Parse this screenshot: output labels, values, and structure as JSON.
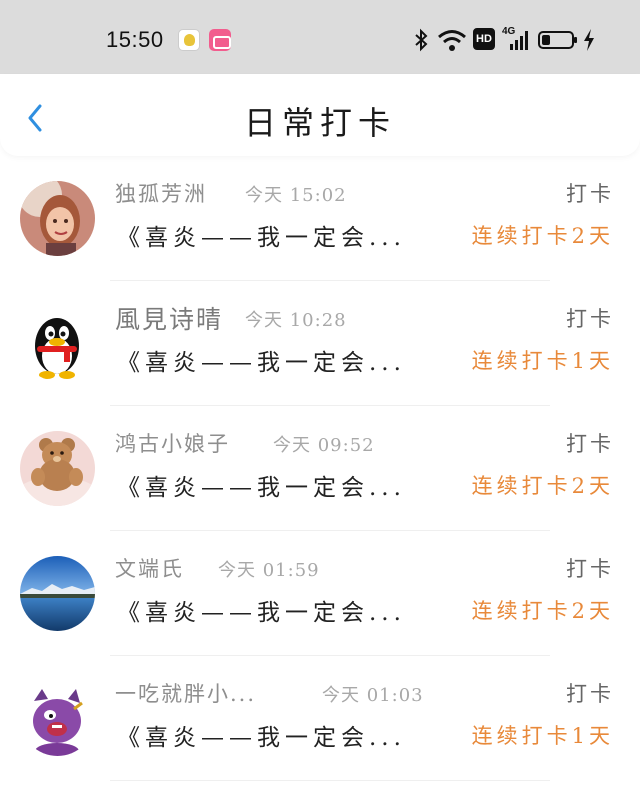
{
  "status_bar": {
    "time": "15:50",
    "icons": [
      "app-icon-1",
      "bilibili-icon",
      "bluetooth-icon",
      "wifi-icon",
      "hd-icon",
      "signal-4g-icon",
      "battery-icon",
      "charging-icon"
    ],
    "hd_label": "HD",
    "network_label": "4G"
  },
  "header": {
    "title": "日常打卡",
    "back_icon": "chevron-left-icon"
  },
  "colors": {
    "accent": "#2f8fe0",
    "streak": "#e8893a",
    "status_bar_bg": "#dcdcdc"
  },
  "checkins": [
    {
      "name": "独孤芳洲",
      "time": "今天 15:02",
      "action": "打卡",
      "content": "《喜炎——我一定会...",
      "streak": "连续打卡2天",
      "avatar": "girl-photo"
    },
    {
      "name": "風見诗晴",
      "time": "今天 10:28",
      "action": "打卡",
      "content": "《喜炎——我一定会...",
      "streak": "连续打卡1天",
      "avatar": "qq-penguin"
    },
    {
      "name": "鸿古小娘子",
      "time": "今天 09:52",
      "action": "打卡",
      "content": "《喜炎——我一定会...",
      "streak": "连续打卡2天",
      "avatar": "teddy-bear"
    },
    {
      "name": "文端氏",
      "time": "今天 01:59",
      "action": "打卡",
      "content": "《喜炎——我一定会...",
      "streak": "连续打卡2天",
      "avatar": "lake-mountain"
    },
    {
      "name": "一吃就胖小...",
      "time": "今天 01:03",
      "action": "打卡",
      "content": "《喜炎——我一定会...",
      "streak": "连续打卡1天",
      "avatar": "cartoon-character"
    }
  ]
}
